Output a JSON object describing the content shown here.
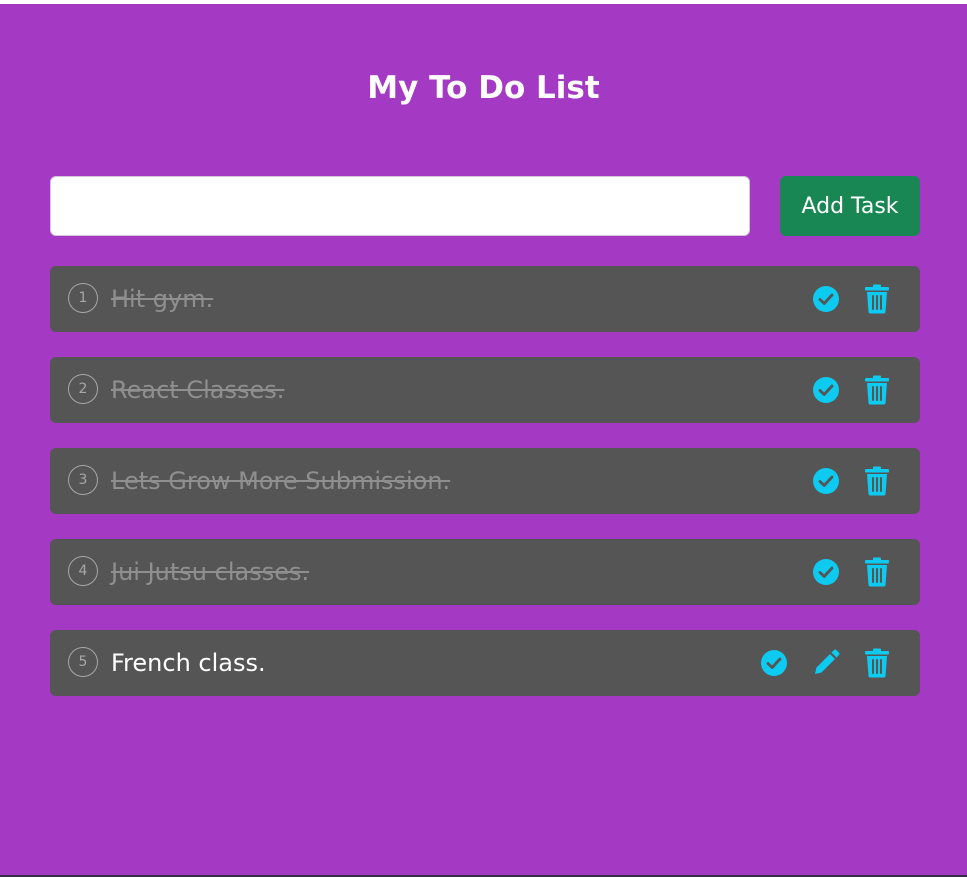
{
  "page": {
    "title": "My To Do List"
  },
  "form": {
    "input_value": "",
    "input_placeholder": "",
    "add_button_label": "Add Task"
  },
  "colors": {
    "background": "#a43ac4",
    "task_row": "#555555",
    "add_button": "#198754",
    "icon_accent": "#0dcaf0",
    "completed_text": "#8f8f8f"
  },
  "tasks": [
    {
      "number": "1",
      "text": "Hit gym.",
      "completed": true,
      "icons": [
        "check-circle-icon",
        "trash-icon"
      ]
    },
    {
      "number": "2",
      "text": "React Classes.",
      "completed": true,
      "icons": [
        "check-circle-icon",
        "trash-icon"
      ]
    },
    {
      "number": "3",
      "text": "Lets Grow More Submission.",
      "completed": true,
      "icons": [
        "check-circle-icon",
        "trash-icon"
      ]
    },
    {
      "number": "4",
      "text": "Jui Jutsu classes.",
      "completed": true,
      "icons": [
        "check-circle-icon",
        "trash-icon"
      ]
    },
    {
      "number": "5",
      "text": "French class.",
      "completed": false,
      "icons": [
        "check-circle-icon",
        "pencil-icon",
        "trash-icon"
      ]
    }
  ]
}
